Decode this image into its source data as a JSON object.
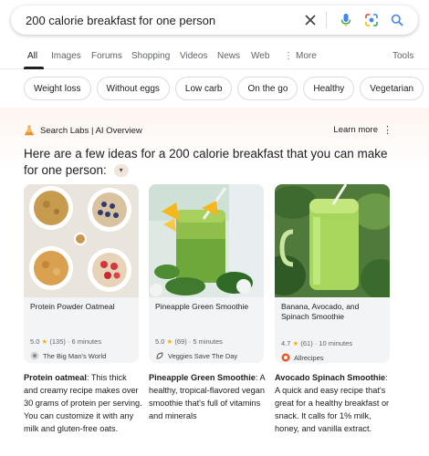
{
  "search": {
    "query": "200 calorie breakfast for one person"
  },
  "tabs": [
    "All",
    "Images",
    "Forums",
    "Shopping",
    "Videos",
    "News",
    "Web",
    "More",
    "Tools"
  ],
  "chips": [
    "Weight loss",
    "Without eggs",
    "Low carb",
    "On the go",
    "Healthy",
    "Vegetarian"
  ],
  "overview": {
    "label": "Search Labs | AI Overview",
    "learn_more": "Learn more",
    "headline": "Here are a few ideas for a 200 calorie breakfast that you can make for one person:"
  },
  "cards": [
    {
      "title": "Protein Powder Oatmeal",
      "rating": "5.0",
      "reviews": "(135)",
      "time": "6 minutes",
      "source": "The Big Man's World"
    },
    {
      "title": "Pineapple Green Smoothie",
      "rating": "5.0",
      "reviews": "(69)",
      "time": "5 minutes",
      "source": "Veggies Save The Day"
    },
    {
      "title": "Banana, Avocado, and Spinach Smoothie",
      "rating": "4.7",
      "reviews": "(61)",
      "time": "10 minutes",
      "source": "Allrecipes"
    }
  ],
  "descriptions": [
    {
      "bold": "Protein oatmeal",
      "text": ": This thick and creamy recipe makes over 30 grams of protein per serving. You can customize it with any milk and gluten-free oats."
    },
    {
      "bold": "Pineapple Green Smoothie",
      "text": ": A healthy, tropical-flavored vegan smoothie that's full of vitamins and minerals"
    },
    {
      "bold": "Avocado Spinach Smoothie",
      "text": ": A quick and easy recipe that's great for a healthy breakfast or snack. It calls for 1% milk, honey, and vanilla extract."
    }
  ],
  "colors": {
    "google_blue": "#4285f4",
    "star": "#f5b400",
    "overview_tint": "#fdf5f0"
  },
  "icons": [
    "clear-icon",
    "mic-icon",
    "lens-icon",
    "search-icon",
    "flask-icon",
    "more-vert-icon",
    "chevron-down-icon"
  ]
}
